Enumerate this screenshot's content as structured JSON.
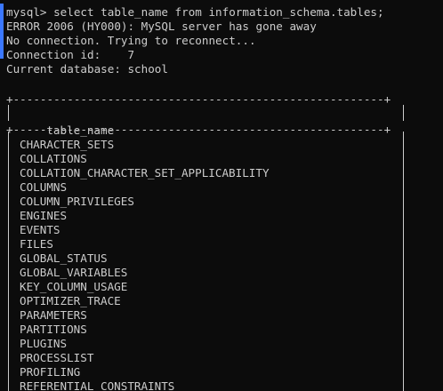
{
  "colors": {
    "background": "#0c0c0c",
    "text": "#cccccc",
    "selection_bar": "#3b78ff"
  },
  "console": {
    "prompt_line": "mysql> select table_name from information_schema.tables;",
    "error_line": "ERROR 2006 (HY000): MySQL server has gone away",
    "reconnect_line": "No connection. Trying to reconnect...",
    "connection_line": "Connection id:    7",
    "database_line": "Current database: school"
  },
  "table": {
    "border_top": "+-------------------------------------------------------+",
    "border_mid": "+-------------------------------------------------------+",
    "header": "table_name",
    "rows": [
      "CHARACTER_SETS",
      "COLLATIONS",
      "COLLATION_CHARACTER_SET_APPLICABILITY",
      "COLUMNS",
      "COLUMN_PRIVILEGES",
      "ENGINES",
      "EVENTS",
      "FILES",
      "GLOBAL_STATUS",
      "GLOBAL_VARIABLES",
      "KEY_COLUMN_USAGE",
      "OPTIMIZER_TRACE",
      "PARAMETERS",
      "PARTITIONS",
      "PLUGINS",
      "PROCESSLIST",
      "PROFILING",
      "REFERENTIAL_CONSTRAINTS"
    ]
  }
}
